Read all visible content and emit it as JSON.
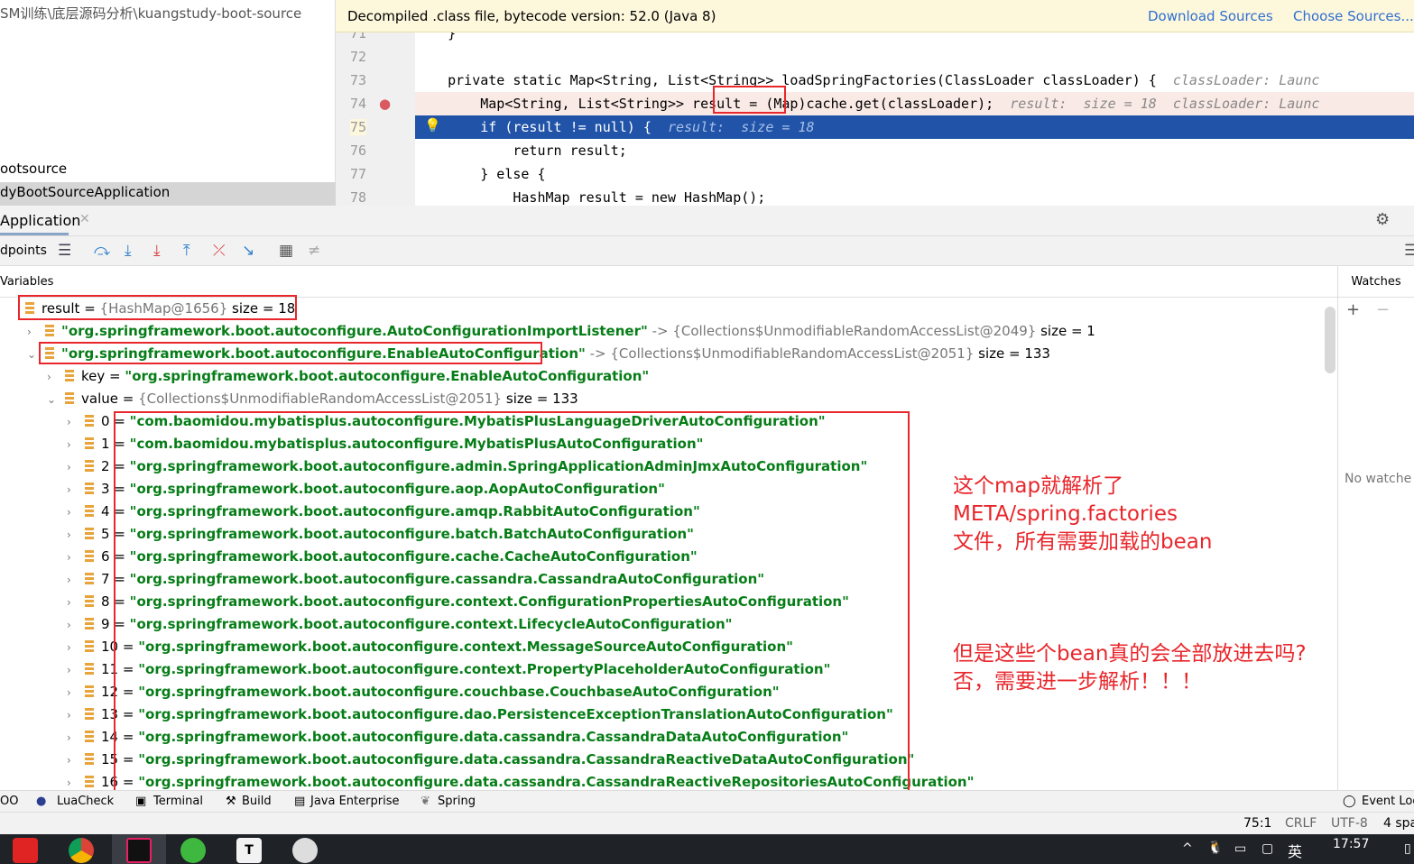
{
  "project": {
    "path": "SM训练\\底层源码分析\\kuangstudy-boot-source",
    "node1": "ootsource",
    "node2": "dyBootSourceApplication"
  },
  "editor": {
    "banner": "Decompiled .class file, bytecode version: 52.0 (Java 8)",
    "download_sources": "Download Sources",
    "choose_sources": "Choose Sources...",
    "lines": [
      {
        "n": "71",
        "code": "    }"
      },
      {
        "n": "72",
        "code": ""
      },
      {
        "n": "73",
        "code": "    private static Map<String, List<String>> loadSpringFactories(ClassLoader classLoader) {",
        "hint": "  classLoader: Launc"
      },
      {
        "n": "74",
        "code": "        Map<String, List<String>> result = (Map)cache.get(classLoader);",
        "hint": "  result:  size = 18  classLoader: Launc"
      },
      {
        "n": "75",
        "code": "        if (result != null) {",
        "hint": "  result:  size = 18"
      },
      {
        "n": "76",
        "code": "            return result;"
      },
      {
        "n": "77",
        "code": "        } else {"
      },
      {
        "n": "78",
        "code": "            HashMap result = new HashMap();"
      }
    ]
  },
  "debug": {
    "tab": "Application",
    "breakpoints": "dpoints",
    "variables": "Variables",
    "watches": "Watches",
    "no_watches": "No watche"
  },
  "tree": [
    {
      "indent": 0,
      "arrow": "",
      "name": "result",
      "eq": " = ",
      "val": "{HashMap@1656}",
      "extra": "  size = 18"
    },
    {
      "indent": 1,
      "arrow": "›",
      "str": "\"org.springframework.boot.autoconfigure.AutoConfigurationImportListener\"",
      "val": " -> {Collections$UnmodifiableRandomAccessList@2049}",
      "extra": "  size = 1"
    },
    {
      "indent": 1,
      "arrow": "⌄",
      "str": "\"org.springframework.boot.autoconfigure.EnableAutoConfiguration\"",
      "val": " -> {Collections$UnmodifiableRandomAccessList@2051}",
      "extra": "  size = 133"
    },
    {
      "indent": 2,
      "arrow": "›",
      "name": "key",
      "eq": " = ",
      "str": "\"org.springframework.boot.autoconfigure.EnableAutoConfiguration\""
    },
    {
      "indent": 2,
      "arrow": "⌄",
      "name": "value",
      "eq": " = ",
      "val": "{Collections$UnmodifiableRandomAccessList@2051}",
      "extra": "  size = 133"
    },
    {
      "indent": 3,
      "arrow": "›",
      "name": "0",
      "eq": " = ",
      "str": "\"com.baomidou.mybatisplus.autoconfigure.MybatisPlusLanguageDriverAutoConfiguration\""
    },
    {
      "indent": 3,
      "arrow": "›",
      "name": "1",
      "eq": " = ",
      "str": "\"com.baomidou.mybatisplus.autoconfigure.MybatisPlusAutoConfiguration\""
    },
    {
      "indent": 3,
      "arrow": "›",
      "name": "2",
      "eq": " = ",
      "str": "\"org.springframework.boot.autoconfigure.admin.SpringApplicationAdminJmxAutoConfiguration\""
    },
    {
      "indent": 3,
      "arrow": "›",
      "name": "3",
      "eq": " = ",
      "str": "\"org.springframework.boot.autoconfigure.aop.AopAutoConfiguration\""
    },
    {
      "indent": 3,
      "arrow": "›",
      "name": "4",
      "eq": " = ",
      "str": "\"org.springframework.boot.autoconfigure.amqp.RabbitAutoConfiguration\""
    },
    {
      "indent": 3,
      "arrow": "›",
      "name": "5",
      "eq": " = ",
      "str": "\"org.springframework.boot.autoconfigure.batch.BatchAutoConfiguration\""
    },
    {
      "indent": 3,
      "arrow": "›",
      "name": "6",
      "eq": " = ",
      "str": "\"org.springframework.boot.autoconfigure.cache.CacheAutoConfiguration\""
    },
    {
      "indent": 3,
      "arrow": "›",
      "name": "7",
      "eq": " = ",
      "str": "\"org.springframework.boot.autoconfigure.cassandra.CassandraAutoConfiguration\""
    },
    {
      "indent": 3,
      "arrow": "›",
      "name": "8",
      "eq": " = ",
      "str": "\"org.springframework.boot.autoconfigure.context.ConfigurationPropertiesAutoConfiguration\""
    },
    {
      "indent": 3,
      "arrow": "›",
      "name": "9",
      "eq": " = ",
      "str": "\"org.springframework.boot.autoconfigure.context.LifecycleAutoConfiguration\""
    },
    {
      "indent": 3,
      "arrow": "›",
      "name": "10",
      "eq": " = ",
      "str": "\"org.springframework.boot.autoconfigure.context.MessageSourceAutoConfiguration\""
    },
    {
      "indent": 3,
      "arrow": "›",
      "name": "11",
      "eq": " = ",
      "str": "\"org.springframework.boot.autoconfigure.context.PropertyPlaceholderAutoConfiguration\""
    },
    {
      "indent": 3,
      "arrow": "›",
      "name": "12",
      "eq": " = ",
      "str": "\"org.springframework.boot.autoconfigure.couchbase.CouchbaseAutoConfiguration\""
    },
    {
      "indent": 3,
      "arrow": "›",
      "name": "13",
      "eq": " = ",
      "str": "\"org.springframework.boot.autoconfigure.dao.PersistenceExceptionTranslationAutoConfiguration\""
    },
    {
      "indent": 3,
      "arrow": "›",
      "name": "14",
      "eq": " = ",
      "str": "\"org.springframework.boot.autoconfigure.data.cassandra.CassandraDataAutoConfiguration\""
    },
    {
      "indent": 3,
      "arrow": "›",
      "name": "15",
      "eq": " = ",
      "str": "\"org.springframework.boot.autoconfigure.data.cassandra.CassandraReactiveDataAutoConfiguration\""
    },
    {
      "indent": 3,
      "arrow": "›",
      "name": "16",
      "eq": " = ",
      "str": "\"org.springframework.boot.autoconfigure.data.cassandra.CassandraReactiveRepositoriesAutoConfiguration\""
    }
  ],
  "annotations": {
    "note1": "这个map就解析了\nMETA/spring.factories\n文件，所有需要加载的bean",
    "note2": "但是这些个bean真的会全部放进去吗?\n否，需要进一步解析！！！",
    "color": "#e8262b"
  },
  "tools": {
    "todo": "OO",
    "luacheck": "LuaCheck",
    "terminal": "Terminal",
    "build": "Build",
    "java_enterprise": "Java Enterprise",
    "spring": "Spring",
    "event_log": "Event Log"
  },
  "status": {
    "position": "75:1",
    "line_sep": "CRLF",
    "encoding": "UTF-8",
    "indent": "4 spa"
  },
  "taskbar": {
    "time": "17:57",
    "ime": "英"
  }
}
